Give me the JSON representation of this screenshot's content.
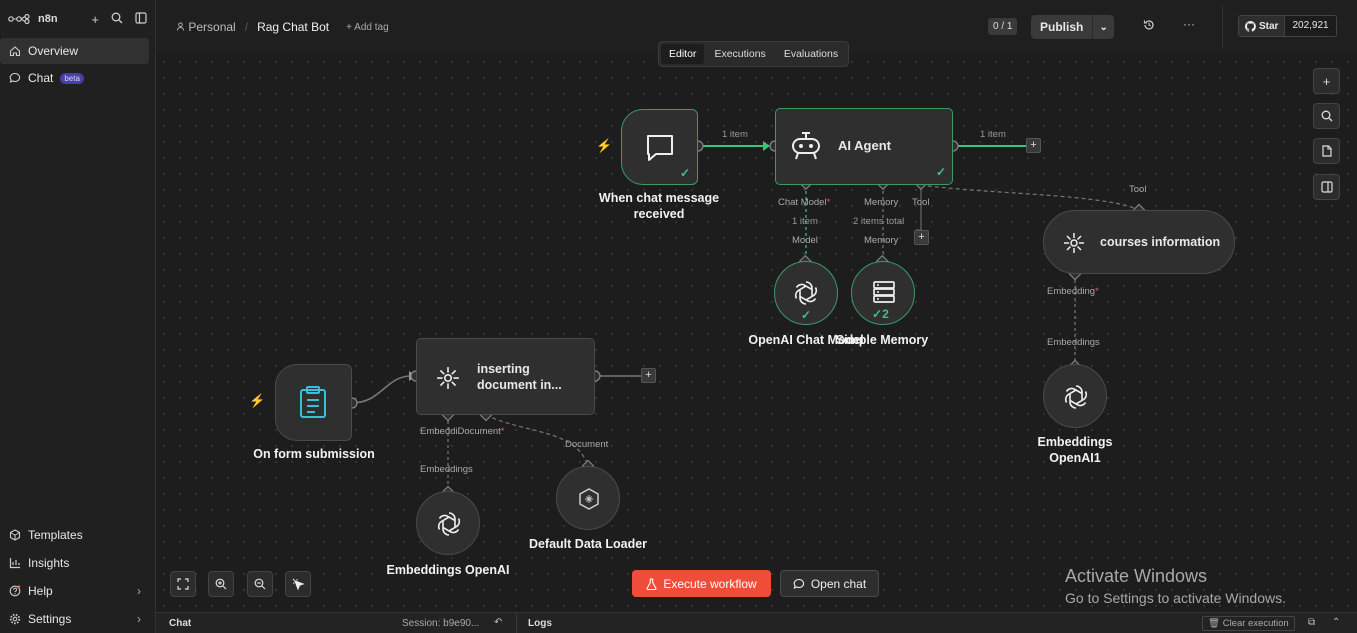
{
  "sidebar": {
    "logo": "n8n",
    "items": [
      {
        "label": "Overview"
      },
      {
        "label": "Chat",
        "badge": "beta"
      }
    ],
    "bottom": [
      {
        "label": "Templates"
      },
      {
        "label": "Insights"
      },
      {
        "label": "Help"
      },
      {
        "label": "Settings"
      }
    ]
  },
  "header": {
    "project": "Personal",
    "workflow": "Rag Chat Bot",
    "add_tag": "+ Add tag",
    "tabs": [
      "Editor",
      "Executions",
      "Evaluations"
    ],
    "counter": "0 / 1",
    "publish": "Publish",
    "github": {
      "star": "Star",
      "count": "202,921"
    }
  },
  "nodes": {
    "chat_trigger": "When chat message received",
    "ai_agent": "AI Agent",
    "openai_chat": "OpenAI Chat Model",
    "memory": "Simple Memory",
    "memory_count": "2",
    "courses": "courses information",
    "embeddings1": "Embeddings OpenAI1",
    "form": "On form submission",
    "inserting": "inserting document in...",
    "embeddings": "Embeddings OpenAI",
    "loader": "Default Data Loader"
  },
  "edges": {
    "trigger_out": "1 item",
    "agent_out": "1 item",
    "model_items": "1 item",
    "memory_items": "2 items total"
  },
  "ports": {
    "chat_model": "Chat Model",
    "memory": "Memory",
    "tool": "Tool",
    "model": "Model",
    "memory_in": "Memory",
    "tool_in": "Tool",
    "embedding": "Embedding",
    "embeddings_in": "Embeddings",
    "embeddi_doc": "EmbeddiDocument",
    "embeddings_in2": "Embeddings",
    "document_in": "Document"
  },
  "controls": {
    "execute": "Execute workflow",
    "open_chat": "Open chat"
  },
  "activate": {
    "line1": "Activate Windows",
    "line2": "Go to Settings to activate Windows."
  },
  "bottombar": {
    "chat": "Chat",
    "session": "Session: b9e90...",
    "logs": "Logs",
    "clear": "Clear execution"
  }
}
